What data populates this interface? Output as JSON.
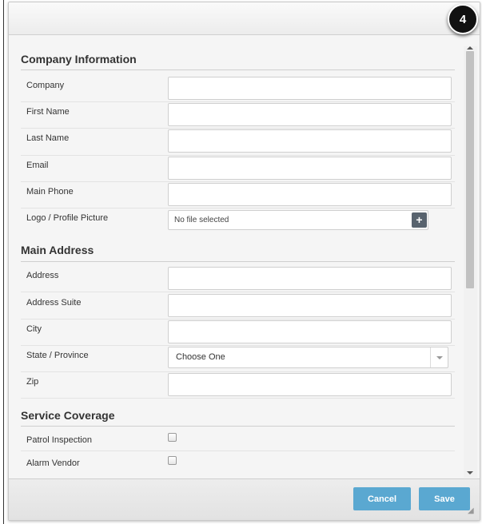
{
  "step_badge": "4",
  "sections": {
    "company_info": "Company Information",
    "main_address": "Main Address",
    "service_coverage": "Service Coverage"
  },
  "company_fields": {
    "company": {
      "label": "Company",
      "value": ""
    },
    "first_name": {
      "label": "First Name",
      "value": ""
    },
    "last_name": {
      "label": "Last Name",
      "value": ""
    },
    "email": {
      "label": "Email",
      "value": ""
    },
    "main_phone": {
      "label": "Main Phone",
      "value": ""
    },
    "logo": {
      "label": "Logo / Profile Picture",
      "file_status": "No file selected",
      "add_icon": "plus-icon"
    }
  },
  "address_fields": {
    "address": {
      "label": "Address",
      "value": ""
    },
    "address_suite": {
      "label": "Address Suite",
      "value": ""
    },
    "city": {
      "label": "City",
      "value": ""
    },
    "state": {
      "label": "State / Province",
      "selected": "Choose One"
    },
    "zip": {
      "label": "Zip",
      "value": ""
    }
  },
  "coverage": {
    "patrol_inspection": {
      "label": "Patrol Inspection",
      "checked": false
    },
    "alarm_vendor": {
      "label": "Alarm Vendor",
      "checked": false
    }
  },
  "footer": {
    "cancel_label": "Cancel",
    "save_label": "Save"
  },
  "colors": {
    "button": "#5aa8d1",
    "badge": "#111111"
  }
}
